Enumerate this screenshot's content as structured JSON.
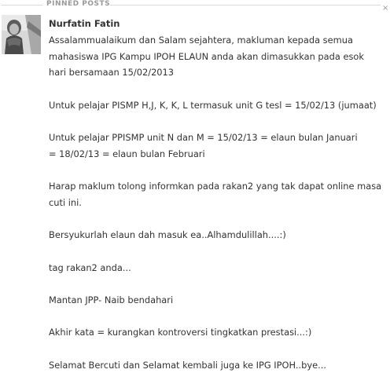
{
  "section": {
    "title": "PINNED POSTS",
    "close_glyph": "×"
  },
  "post": {
    "author": "Nurfatin Fatin",
    "avatar_icon": "profile-photo",
    "lines": [
      "Assalammualaikum dan Salam sejahtera, makluman kepada semua",
      "mahasiswa IPG Kampu IPOH ELAUN anda akan dimasukkan pada esok",
      "hari bersamaan 15/02/2013",
      "",
      "Untuk pelajar PISMP H,J, K, K, L termasuk unit G tesl = 15/02/13 (jumaat)",
      "",
      "Untuk pelajar PPISMP unit N dan M = 15/02/13 = elaun bulan Januari",
      "= 18/02/13 = elaun bulan Februari",
      "",
      "Harap maklum tolong informkan pada rakan2 yang tak dapat online masa",
      "cuti ini.",
      "",
      "Bersyukurlah elaun dah masuk ea..Alhamdulillah....:)",
      "",
      "tag rakan2 anda...",
      "",
      "Mantan JPP- Naib bendahari",
      "",
      "Akhir kata = kurangkan kontroversi tingkatkan prestasi...:)",
      "",
      "Selamat Bercuti dan Selamat kembali juga ke IPG IPOH..bye..."
    ]
  },
  "colors": {
    "text": "#333333",
    "header": "#999999",
    "rule": "#d9d9d9"
  }
}
